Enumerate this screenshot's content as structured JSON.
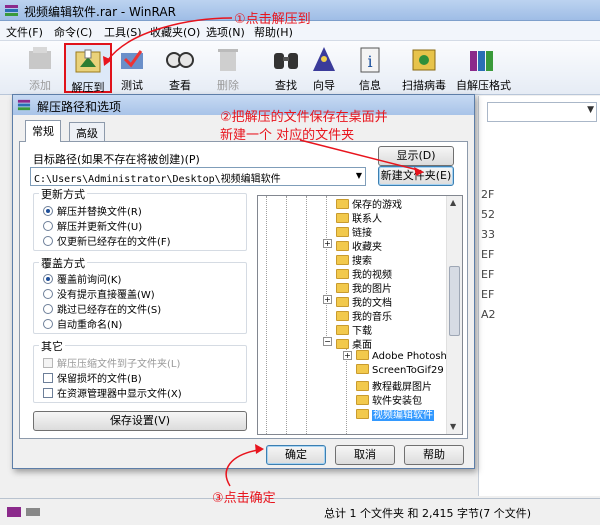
{
  "window": {
    "title": "视频编辑软件.rar - WinRAR"
  },
  "menu": [
    "文件(F)",
    "命令(C)",
    "工具(S)",
    "收藏夹(O)",
    "选项(N)",
    "帮助(H)"
  ],
  "toolbar": [
    {
      "label": "添加",
      "icon": "add-icon",
      "enabled": false
    },
    {
      "label": "解压到",
      "icon": "extract-to-icon",
      "enabled": true,
      "active": true
    },
    {
      "label": "测试",
      "icon": "test-icon",
      "enabled": true
    },
    {
      "label": "查看",
      "icon": "view-icon",
      "enabled": true
    },
    {
      "label": "删除",
      "icon": "delete-icon",
      "enabled": false
    },
    {
      "label": "查找",
      "icon": "find-icon",
      "enabled": true
    },
    {
      "label": "向导",
      "icon": "wizard-icon",
      "enabled": true
    },
    {
      "label": "信息",
      "icon": "info-icon",
      "enabled": true
    },
    {
      "label": "扫描病毒",
      "icon": "virus-scan-icon",
      "enabled": true
    },
    {
      "label": "自解压格式",
      "icon": "sfx-icon",
      "enabled": true
    }
  ],
  "right_list": {
    "values": [
      "2F",
      "52",
      "33",
      "EF",
      "EF",
      "EF",
      "A2"
    ]
  },
  "status": {
    "text": "总计 1 个文件夹 和 2,415 字节(7 个文件)"
  },
  "dialog": {
    "title": "解压路径和选项",
    "tabs": [
      "常规",
      "高级"
    ],
    "dest_label": "目标路径(如果不存在将被创建)(P)",
    "dest_value": "C:\\Users\\Administrator\\Desktop\\视频编辑软件",
    "show_button": "显示(D)",
    "new_folder_button": "新建文件夹(E)",
    "update_group": {
      "title": "更新方式",
      "options": [
        "解压并替换文件(R)",
        "解压并更新文件(U)",
        "仅更新已经存在的文件(F)"
      ],
      "selected": 0
    },
    "overwrite_group": {
      "title": "覆盖方式",
      "options": [
        "覆盖前询问(K)",
        "没有提示直接覆盖(W)",
        "跳过已经存在的文件(S)",
        "自动重命名(N)"
      ],
      "selected": 0
    },
    "misc_group": {
      "title": "其它",
      "options": [
        "解压压缩文件到子文件夹(L)",
        "保留损坏的文件(B)",
        "在资源管理器中显示文件(X)"
      ],
      "disabled": [
        true,
        false,
        false
      ]
    },
    "save_button": "保存设置(V)",
    "ok_button": "确定",
    "cancel_button": "取消",
    "help_button": "帮助",
    "tree": [
      {
        "label": "保存的游戏",
        "level": 2,
        "expander": false
      },
      {
        "label": "联系人",
        "level": 2,
        "expander": false
      },
      {
        "label": "链接",
        "level": 2,
        "expander": false
      },
      {
        "label": "收藏夹",
        "level": 2,
        "expander": true
      },
      {
        "label": "搜索",
        "level": 2,
        "expander": false
      },
      {
        "label": "我的视频",
        "level": 2,
        "expander": false
      },
      {
        "label": "我的图片",
        "level": 2,
        "expander": false
      },
      {
        "label": "我的文档",
        "level": 2,
        "expander": true
      },
      {
        "label": "我的音乐",
        "level": 2,
        "expander": false
      },
      {
        "label": "下载",
        "level": 2,
        "expander": false
      },
      {
        "label": "桌面",
        "level": 2,
        "expander": true
      },
      {
        "label": "Adobe Photoshop",
        "level": 3,
        "expander": true
      },
      {
        "label": "ScreenToGif29",
        "level": 3,
        "expander": false
      },
      {
        "label": "教程截屏图片",
        "level": 3,
        "expander": false
      },
      {
        "label": "软件安装包",
        "level": 3,
        "expander": false
      },
      {
        "label": "视频编辑软件",
        "level": 3,
        "expander": false,
        "selected": true
      }
    ]
  },
  "annotations": {
    "step1": "①点击解压到",
    "step2_line1": "②把解压的文件保存在桌面并",
    "step2_line2": "新建一个 对应的文件夹",
    "step3": "③点击确定",
    "color": "#e8141d"
  }
}
